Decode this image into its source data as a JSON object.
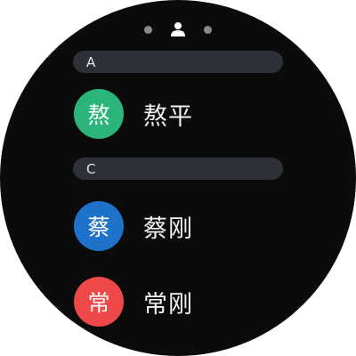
{
  "page_indicator": {
    "icon": "person-icon",
    "dot_color": "#8a8a8a"
  },
  "sections": [
    {
      "letter": "A",
      "contacts": [
        {
          "initial": "熬",
          "name": "熬平",
          "color": "#2bb57a"
        }
      ]
    },
    {
      "letter": "C",
      "contacts": [
        {
          "initial": "蔡",
          "name": "蔡刚",
          "color": "#1f72c9"
        },
        {
          "initial": "常",
          "name": "常刚",
          "color": "#ee4848"
        }
      ]
    }
  ]
}
